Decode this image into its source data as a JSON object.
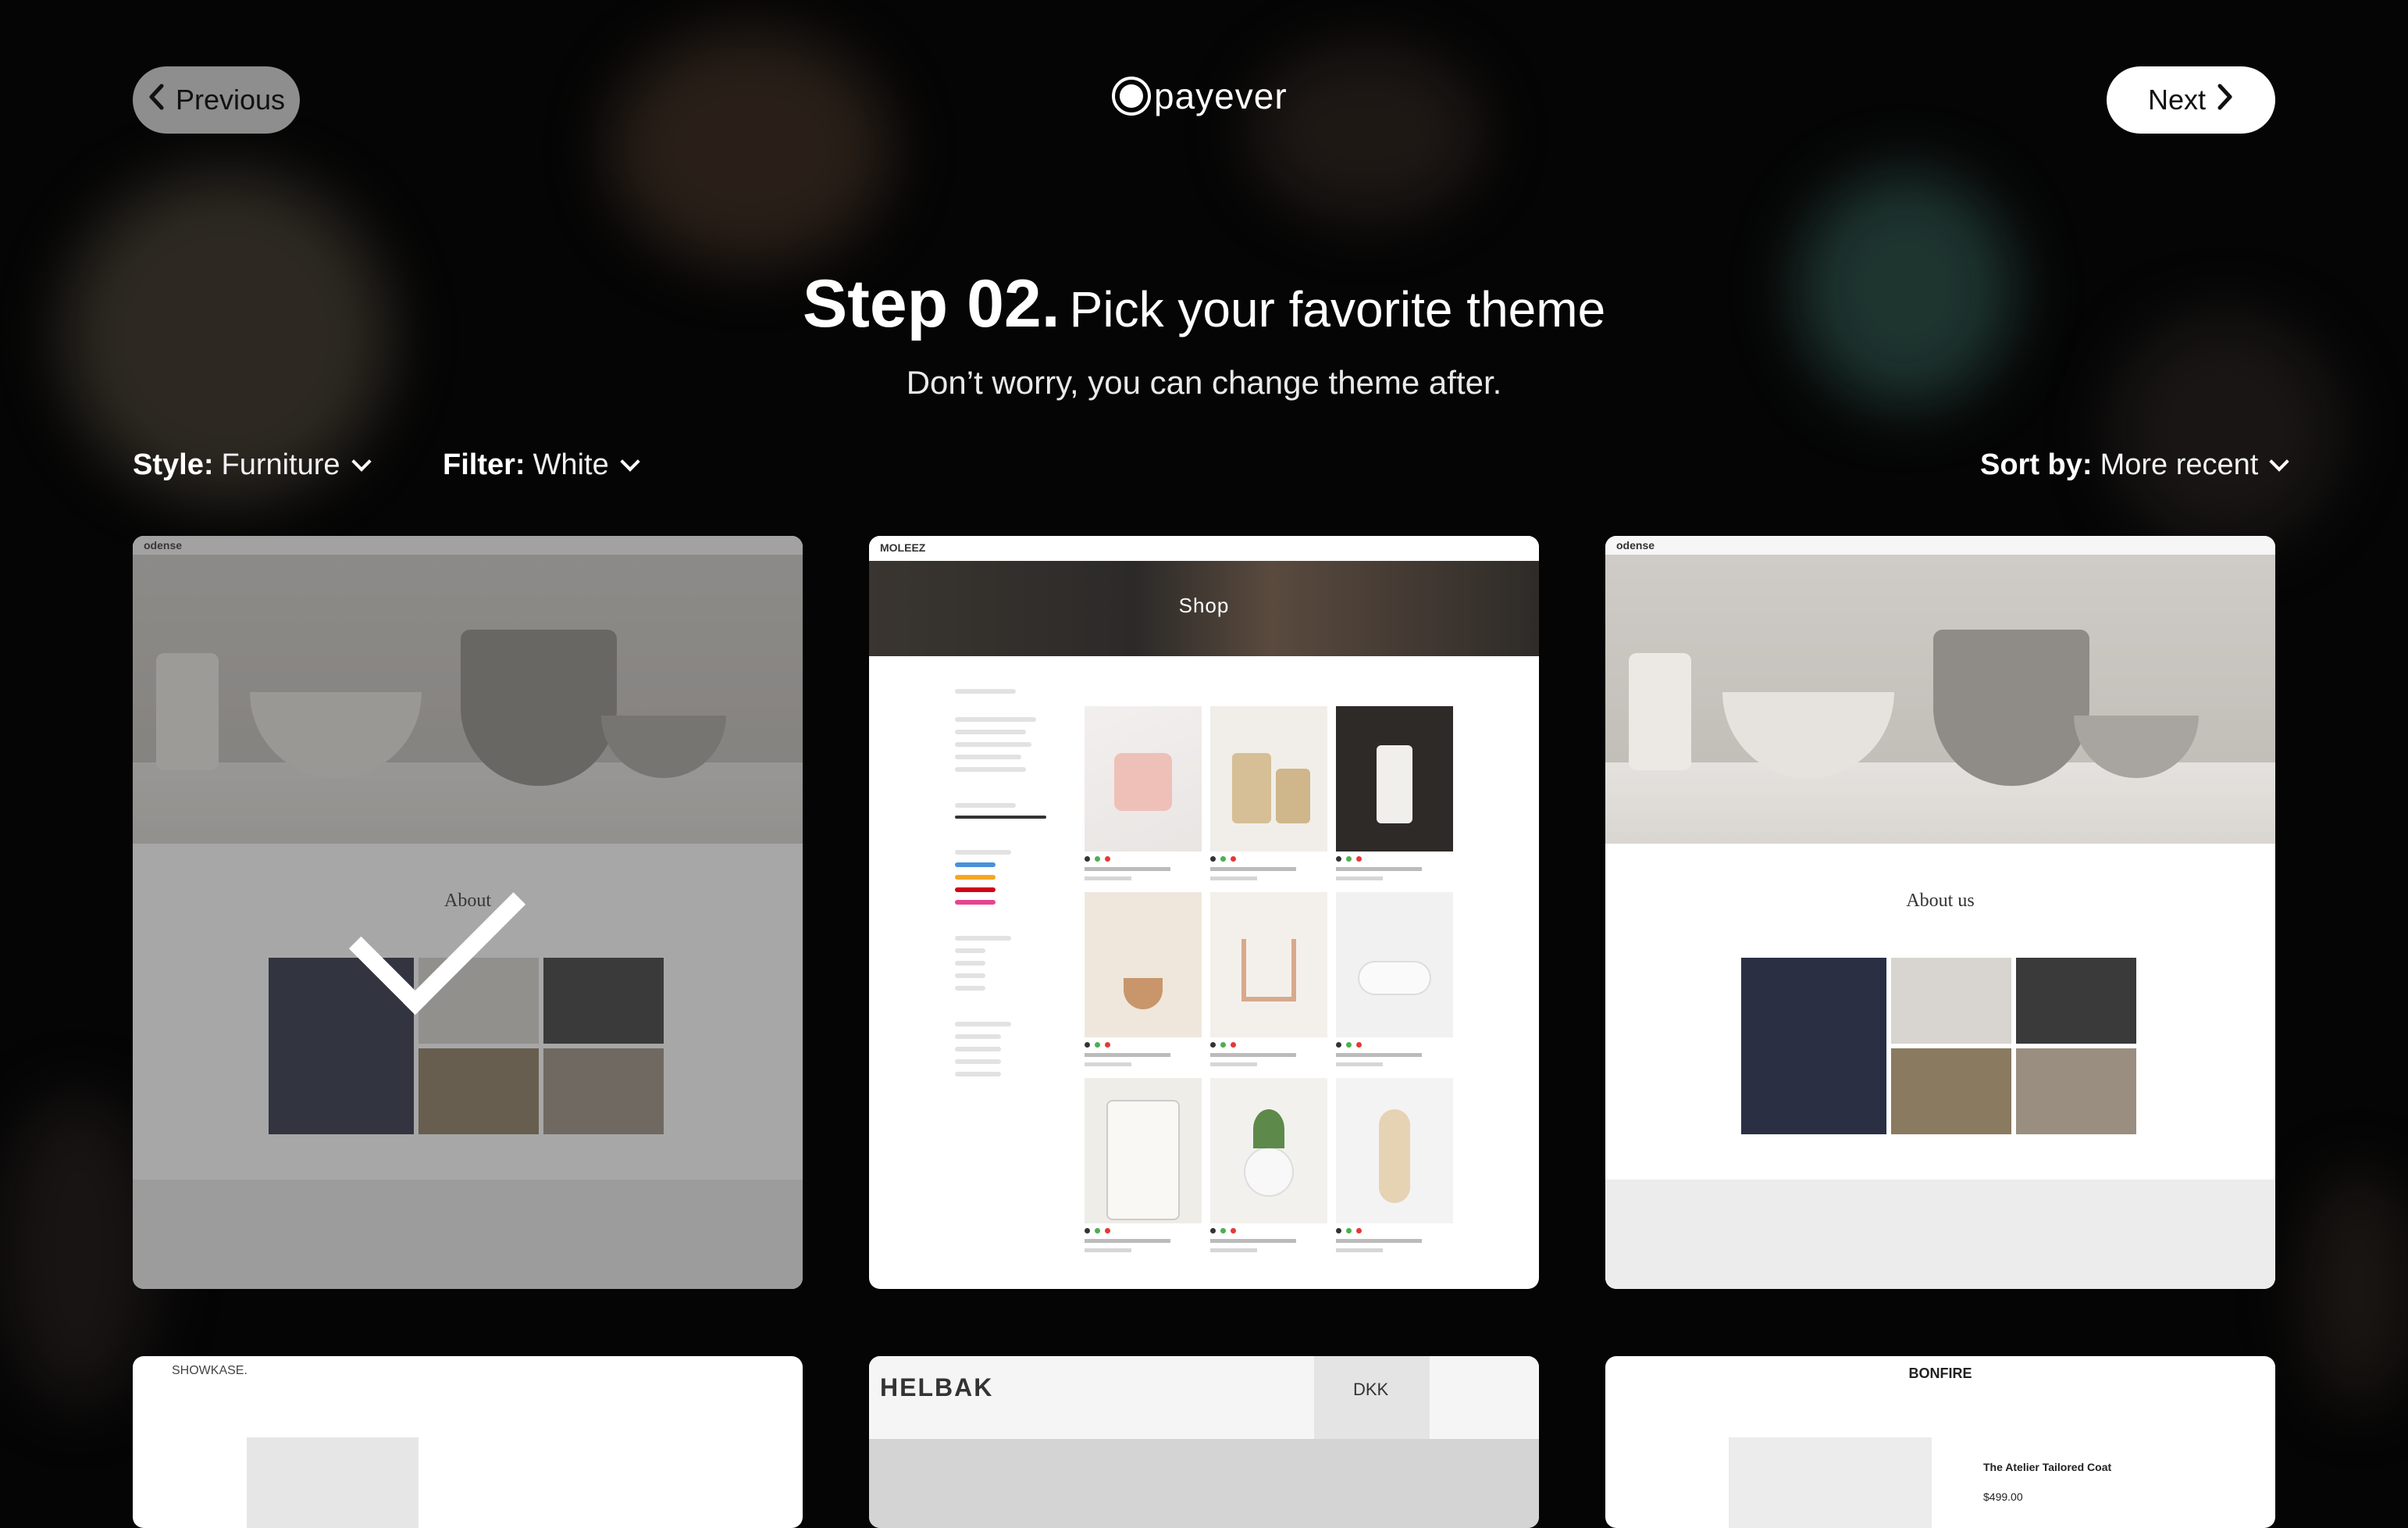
{
  "nav": {
    "previous_label": "Previous",
    "next_label": "Next",
    "logo_text": "payever"
  },
  "heading": {
    "step": "Step 02.",
    "title": "Pick your favorite theme",
    "subtitle": "Don’t worry, you can change theme after."
  },
  "controls": {
    "style_label": "Style:",
    "style_value": "Furniture",
    "filter_label": "Filter:",
    "filter_value": "White",
    "sort_label": "Sort by:",
    "sort_value": "More recent"
  },
  "themes": [
    {
      "brand": "odense",
      "about": "About",
      "selected": true
    },
    {
      "brand": "MOLEEZ",
      "banner": "Shop",
      "selected": false
    },
    {
      "brand": "odense",
      "about": "About us",
      "selected": false
    },
    {
      "brand": "SHOWKASE.",
      "selected": false
    },
    {
      "brand": "HELBAK",
      "currency": "DKK",
      "selected": false
    },
    {
      "brand": "BONFIRE",
      "product": "The Atelier Tailored Coat",
      "price": "$499.00",
      "selected": false
    }
  ],
  "colors": {
    "background": "#050505",
    "selected_overlay": "rgba(60,60,60,0.45)",
    "navy_panel": "#2a2f44"
  }
}
